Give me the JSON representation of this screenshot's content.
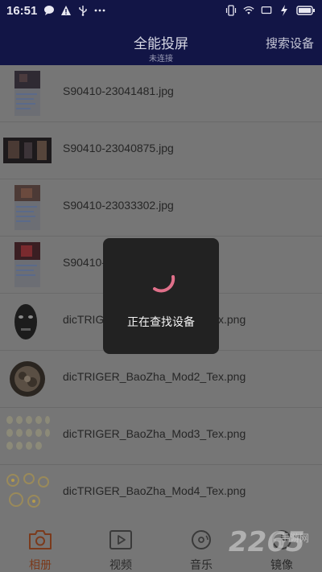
{
  "status_bar": {
    "time": "16:51",
    "left_icons": [
      "chat-bubble-icon",
      "warning-icon",
      "usb-icon",
      "more-dots-icon"
    ],
    "right_icons": [
      "vibrate-icon",
      "wifi-icon",
      "screen-mirror-icon",
      "charging-icon",
      "battery-icon"
    ]
  },
  "app_bar": {
    "title": "全能投屏",
    "subtitle": "未连接",
    "search_label": "搜索设备"
  },
  "files": [
    {
      "name": "S90410-23041481.jpg"
    },
    {
      "name": "S90410-23040875.jpg"
    },
    {
      "name": "S90410-23033302.jpg"
    },
    {
      "name": "S90410-23031895.jpg"
    },
    {
      "name": "dicTRIGER_BaoZha_Mod1_Tex.png"
    },
    {
      "name": "dicTRIGER_BaoZha_Mod2_Tex.png"
    },
    {
      "name": "dicTRIGER_BaoZha_Mod3_Tex.png"
    },
    {
      "name": "dicTRIGER_BaoZha_Mod4_Tex.png"
    }
  ],
  "loading": {
    "message": "正在查找设备"
  },
  "bottom_nav": {
    "items": [
      {
        "label": "相册",
        "icon": "camera-icon",
        "active": true
      },
      {
        "label": "视频",
        "icon": "video-play-icon",
        "active": false
      },
      {
        "label": "音乐",
        "icon": "music-disc-icon",
        "active": false
      },
      {
        "label": "镜像",
        "icon": "mirror-icon",
        "active": false
      }
    ]
  },
  "colors": {
    "header_bg": "#121546",
    "overlay_bg": "#767676",
    "dialog_bg": "#222222",
    "active_tab": "#7b3a1c",
    "spinner": "#e0708a"
  }
}
